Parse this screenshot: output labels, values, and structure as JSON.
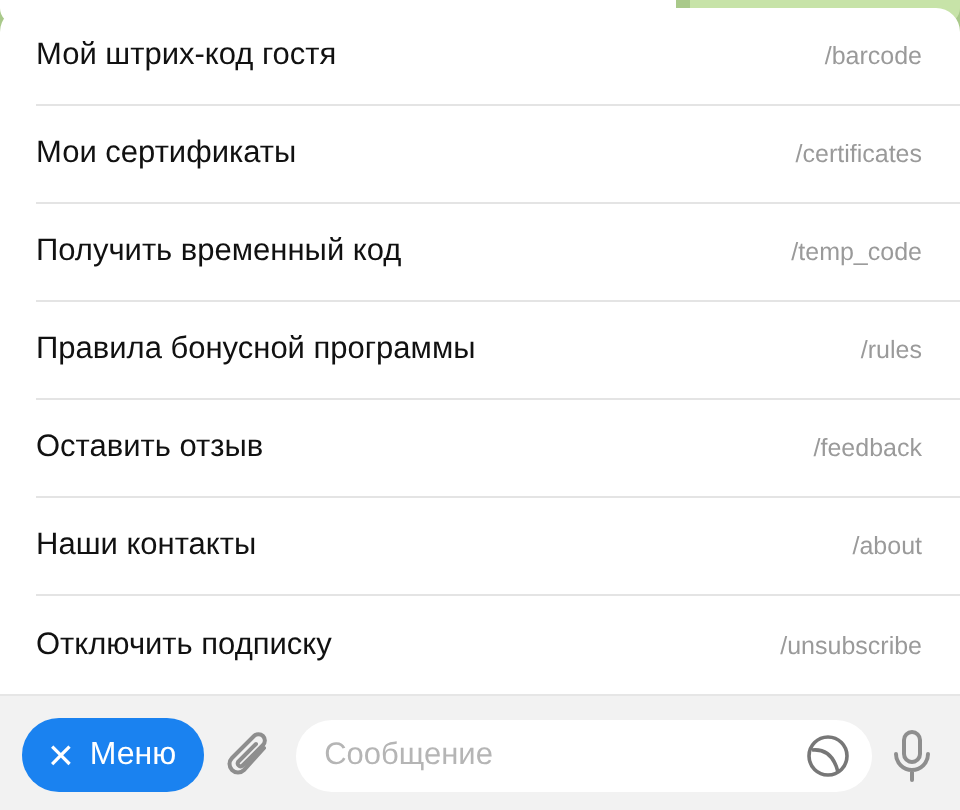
{
  "commands": [
    {
      "label": "Мой штрих-код гостя",
      "command": "/barcode"
    },
    {
      "label": "Мои сертификаты",
      "command": "/certificates"
    },
    {
      "label": "Получить временный код",
      "command": "/temp_code"
    },
    {
      "label": "Правила бонусной программы",
      "command": "/rules"
    },
    {
      "label": "Оставить отзыв",
      "command": "/feedback"
    },
    {
      "label": "Наши контакты",
      "command": "/about"
    },
    {
      "label": "Отключить подписку",
      "command": "/unsubscribe"
    }
  ],
  "input_bar": {
    "menu_button": {
      "icon": "×",
      "label": "Меню"
    },
    "placeholder": "Сообщение"
  }
}
